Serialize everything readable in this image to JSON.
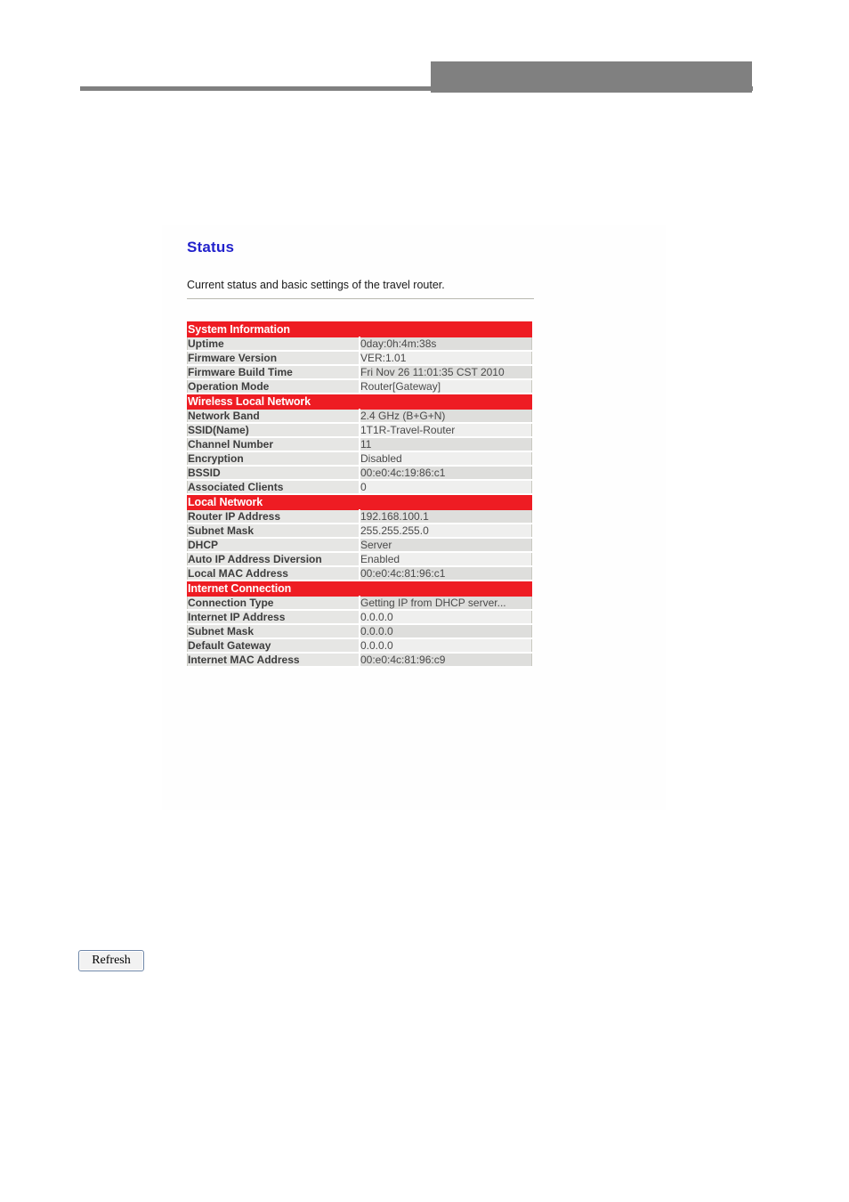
{
  "header": {
    "logo_placeholder": "",
    "rule": ""
  },
  "panel": {
    "title": "Status",
    "description": "Current status and basic settings of the travel router."
  },
  "colors": {
    "section_header_bg": "#ee1c23",
    "title_color": "#2222cc",
    "row_shade_a": "#dededc",
    "row_shade_b": "#efefee",
    "label_bg": "#e6e6e4",
    "header_band": "#808080"
  },
  "status_table": {
    "sections": [
      {
        "title": "System Information",
        "rows": [
          {
            "label": "Uptime",
            "value": "0day:0h:4m:38s"
          },
          {
            "label": "Firmware Version",
            "value": "VER:1.01"
          },
          {
            "label": "Firmware Build Time",
            "value": "Fri Nov 26 11:01:35 CST 2010"
          },
          {
            "label": "Operation Mode",
            "value": "Router[Gateway]"
          }
        ]
      },
      {
        "title": "Wireless Local Network",
        "rows": [
          {
            "label": "Network Band",
            "value": "2.4 GHz (B+G+N)"
          },
          {
            "label": "SSID(Name)",
            "value": "1T1R-Travel-Router"
          },
          {
            "label": "Channel Number",
            "value": "11"
          },
          {
            "label": "Encryption",
            "value": "Disabled"
          },
          {
            "label": "BSSID",
            "value": "00:e0:4c:19:86:c1"
          },
          {
            "label": "Associated Clients",
            "value": "0"
          }
        ]
      },
      {
        "title": "Local Network",
        "rows": [
          {
            "label": "Router IP Address",
            "value": "192.168.100.1"
          },
          {
            "label": "Subnet Mask",
            "value": "255.255.255.0"
          },
          {
            "label": "DHCP",
            "value": "Server"
          },
          {
            "label": "Auto IP Address Diversion",
            "value": "Enabled"
          },
          {
            "label": "Local MAC Address",
            "value": "00:e0:4c:81:96:c1"
          }
        ]
      },
      {
        "title": "Internet Connection",
        "rows": [
          {
            "label": "Connection Type",
            "value": "Getting IP from DHCP server..."
          },
          {
            "label": "Internet IP Address",
            "value": "0.0.0.0"
          },
          {
            "label": "Subnet Mask",
            "value": "0.0.0.0"
          },
          {
            "label": "Default Gateway",
            "value": "0.0.0.0"
          },
          {
            "label": "Internet MAC Address",
            "value": "00:e0:4c:81:96:c9"
          }
        ]
      }
    ]
  },
  "actions": {
    "refresh_label": "Refresh"
  }
}
